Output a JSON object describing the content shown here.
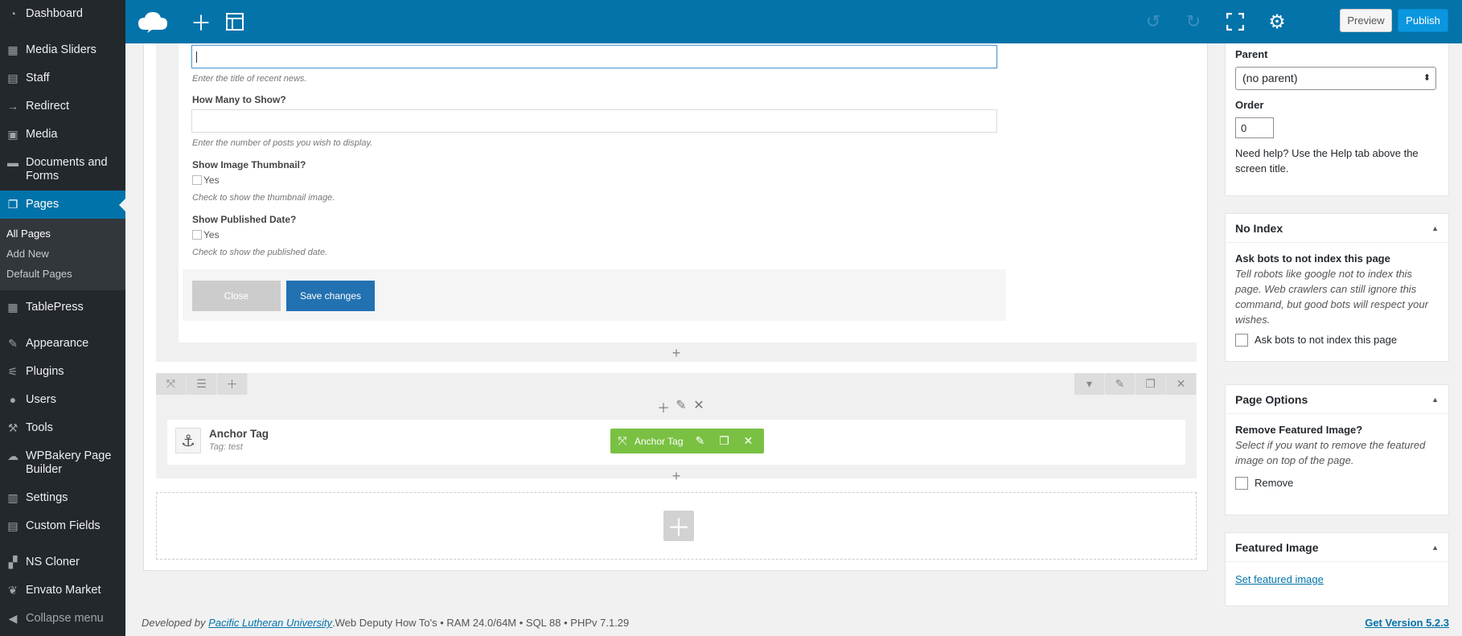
{
  "sidebar": {
    "items": [
      {
        "label": "Dashboard",
        "icon": "dashboard-icon"
      },
      {
        "label": "Media Sliders",
        "icon": "slides-icon"
      },
      {
        "label": "Staff",
        "icon": "id-card-icon"
      },
      {
        "label": "Redirect",
        "icon": "arrow-right-icon"
      },
      {
        "label": "Media",
        "icon": "media-icon"
      },
      {
        "label": "Documents and Forms",
        "icon": "folder-icon"
      },
      {
        "label": "Pages",
        "icon": "page-icon"
      },
      {
        "label": "TablePress",
        "icon": "table-icon"
      },
      {
        "label": "Appearance",
        "icon": "brush-icon"
      },
      {
        "label": "Plugins",
        "icon": "plug-icon"
      },
      {
        "label": "Users",
        "icon": "user-icon"
      },
      {
        "label": "Tools",
        "icon": "wrench-icon"
      },
      {
        "label": "WPBakery Page Builder",
        "icon": "cloud-icon"
      },
      {
        "label": "Settings",
        "icon": "settings-icon"
      },
      {
        "label": "Custom Fields",
        "icon": "fields-icon"
      },
      {
        "label": "NS Cloner",
        "icon": "cloner-icon"
      },
      {
        "label": "Envato Market",
        "icon": "leaf-icon"
      },
      {
        "label": "Collapse menu",
        "icon": "collapse-icon"
      }
    ],
    "pages_sub": [
      "All Pages",
      "Add New",
      "Default Pages"
    ]
  },
  "topbar": {
    "preview": "Preview",
    "publish": "Publish"
  },
  "form": {
    "title_hint": "Enter the title of recent news.",
    "count_label": "How Many to Show?",
    "count_hint": "Enter the number of posts you wish to display.",
    "thumb_label": "Show Image Thumbnail?",
    "thumb_yes": "Yes",
    "thumb_hint": "Check to show the thumbnail image.",
    "date_label": "Show Published Date?",
    "date_yes": "Yes",
    "date_hint": "Check to show the published date.",
    "close": "Close",
    "save": "Save changes"
  },
  "element": {
    "title": "Anchor Tag",
    "subtitle": "Tag: test",
    "bar_label": "Anchor Tag"
  },
  "page_attributes": {
    "parent_label": "Parent",
    "parent_value": "(no parent)",
    "order_label": "Order",
    "order_value": "0",
    "help": "Need help? Use the Help tab above the screen title."
  },
  "no_index": {
    "title": "No Index",
    "heading": "Ask bots to not index this page",
    "desc": "Tell robots like google not to index this page. Web crawlers can still ignore this command, but good bots will respect your wishes.",
    "checkbox": "Ask bots to not index this page"
  },
  "page_options": {
    "title": "Page Options",
    "heading": "Remove Featured Image?",
    "desc": "Select if you want to remove the featured image on top of the page.",
    "checkbox": "Remove"
  },
  "featured_image": {
    "title": "Featured Image",
    "link": "Set featured image"
  },
  "footer": {
    "prefix": "Developed by",
    "university": "Pacific Lutheran University",
    "stats": ".Web Deputy How To's • RAM 24.0/64M • SQL 88 • PHPv 7.1.29",
    "version": "Get Version 5.2.3"
  }
}
